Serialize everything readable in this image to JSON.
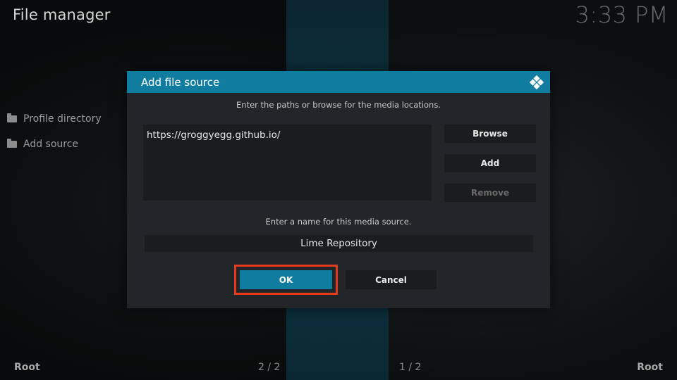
{
  "header": {
    "title": "File manager",
    "clock": "3:33 PM"
  },
  "sidebar": {
    "items": [
      {
        "label": "Profile directory",
        "icon": "folder-icon"
      },
      {
        "label": "Add source",
        "icon": "folder-icon"
      }
    ]
  },
  "footer": {
    "left_label": "Root",
    "left_page": "2 / 2",
    "right_page": "1 / 2",
    "right_label": "Root"
  },
  "dialog": {
    "title": "Add file source",
    "instructions": "Enter the paths or browse for the media locations.",
    "paths": [
      "https://groggyegg.github.io/"
    ],
    "browse_label": "Browse",
    "add_label": "Add",
    "remove_label": "Remove",
    "name_instructions": "Enter a name for this media source.",
    "name_value": "Lime Repository",
    "ok_label": "OK",
    "cancel_label": "Cancel"
  },
  "colors": {
    "accent": "#0f7ca0",
    "highlight": "#e23b1d",
    "dialog_bg": "#232628"
  }
}
